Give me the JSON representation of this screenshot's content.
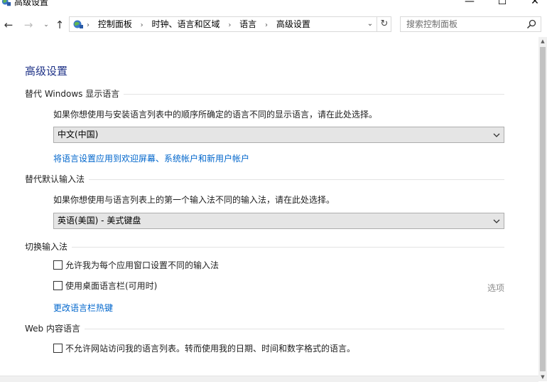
{
  "window": {
    "title": "高级设置",
    "minimize": "—",
    "maximize": "☐",
    "close": "✕"
  },
  "nav": {
    "back": "←",
    "forward": "→",
    "recent": "⌄",
    "up": "↑",
    "breadcrumbs": [
      "控制面板",
      "时钟、语言和区域",
      "语言",
      "高级设置"
    ],
    "separator": "›",
    "dropdown": "⌄",
    "refresh": "↻",
    "search_placeholder": "搜索控制面板"
  },
  "page": {
    "title": "高级设置",
    "display_language": {
      "heading": "替代 Windows 显示语言",
      "description": "如果你想使用与安装语言列表中的顺序所确定的语言不同的显示语言，请在此处选择。",
      "selected": "中文(中国)",
      "link": "将语言设置应用到欢迎屏幕、系统帐户和新用户帐户"
    },
    "input_method": {
      "heading": "替代默认输入法",
      "description": "如果你想使用与语言列表上的第一个输入法不同的输入法，请在此处选择。",
      "selected": "英语(美国) - 美式键盘"
    },
    "switch_input": {
      "heading": "切换输入法",
      "per_app_label": "允许我为每个应用窗口设置不同的输入法",
      "per_app_checked": false,
      "language_bar_label": "使用桌面语言栏(可用时)",
      "language_bar_checked": false,
      "options_label": "选项",
      "hotkey_link": "更改语言栏热键"
    },
    "web_content": {
      "heading": "Web 内容语言",
      "no_access_label": "不允许网站访问我的语言列表。转而使用我的日期、时间和数字格式的语言。",
      "no_access_checked": false
    }
  },
  "colors": {
    "title_blue": "#1e3287",
    "link_blue": "#0066cc",
    "select_bg": "#e5e5e5"
  }
}
